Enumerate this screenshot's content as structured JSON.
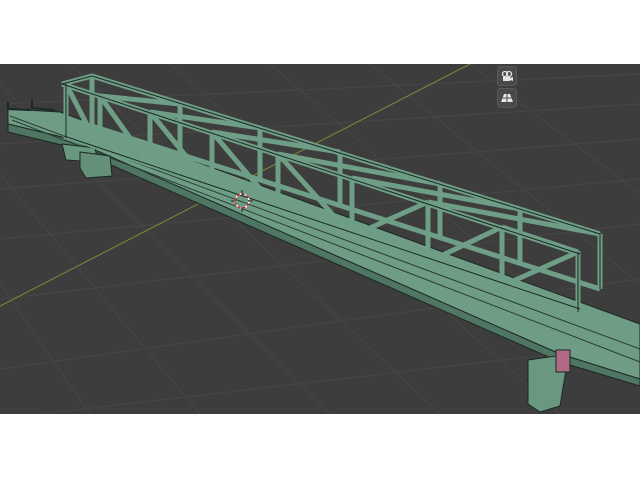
{
  "viewport": {
    "background": "#3d3d3d",
    "grid_color": "#4a4a4a",
    "x_axis_color": "#8a4a4a",
    "y_axis_color": "#8a9a3a",
    "model_color": "#6f9e86",
    "model_edge_color": "#1c2a24"
  },
  "gizmos": [
    {
      "name": "view-camera-icon"
    },
    {
      "name": "perspective-grid-icon"
    }
  ]
}
